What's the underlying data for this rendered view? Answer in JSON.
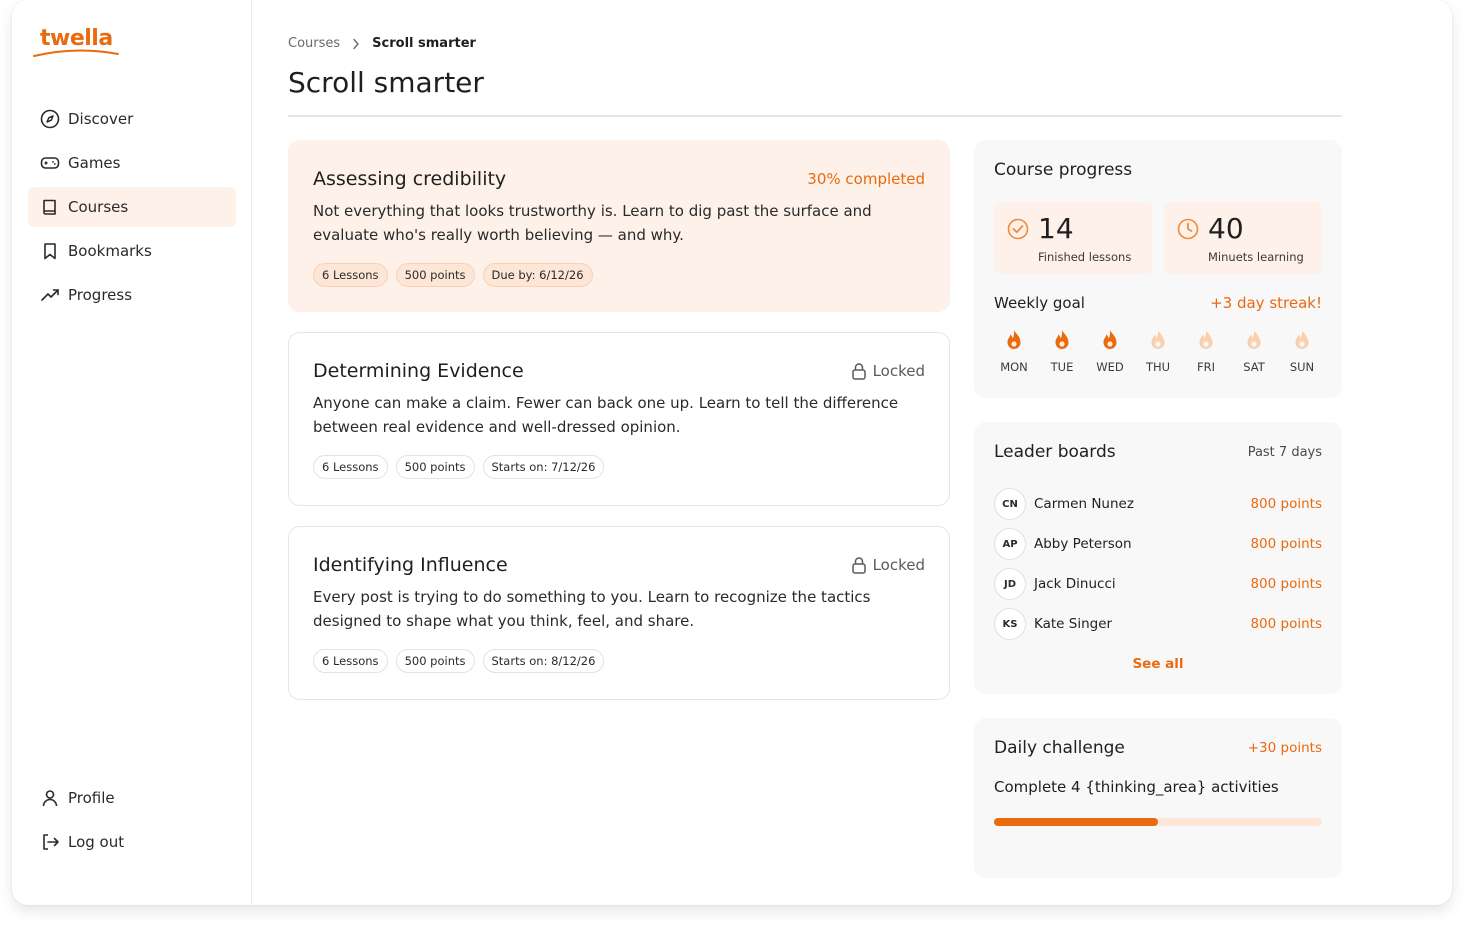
{
  "brand": {
    "name": "twella",
    "accent": "#ea6a10"
  },
  "sidebar": {
    "items": [
      {
        "label": "Discover",
        "icon": "compass-icon"
      },
      {
        "label": "Games",
        "icon": "gamepad-icon"
      },
      {
        "label": "Courses",
        "icon": "book-icon",
        "active": true
      },
      {
        "label": "Bookmarks",
        "icon": "bookmark-icon"
      },
      {
        "label": "Progress",
        "icon": "trending-up-icon"
      }
    ],
    "bottom": [
      {
        "label": "Profile",
        "icon": "user-icon"
      },
      {
        "label": "Log out",
        "icon": "logout-icon"
      }
    ]
  },
  "breadcrumb": {
    "parent": "Courses",
    "current": "Scroll smarter"
  },
  "page": {
    "title": "Scroll smarter"
  },
  "courses": [
    {
      "title": "Assessing credibility",
      "status": "30% completed",
      "description": "Not everything that looks trustworthy is. Learn to dig past the surface and evaluate who's really worth believing — and why.",
      "tags": [
        "6 Lessons",
        "500 points",
        "Due by: 6/12/26"
      ]
    },
    {
      "title": "Determining Evidence",
      "status": "Locked",
      "description": "Anyone can make a claim. Fewer can back one up. Learn to tell the difference between real evidence and well-dressed opinion.",
      "tags": [
        "6 Lessons",
        "500 points",
        "Starts on: 7/12/26"
      ]
    },
    {
      "title": "Identifying Influence",
      "status": "Locked",
      "description": "Every post is trying to do something to you. Learn to recognize the tactics designed to shape what you think, feel, and share.",
      "tags": [
        "6 Lessons",
        "500 points",
        "Starts on: 8/12/26"
      ]
    }
  ],
  "progress": {
    "title": "Course progress",
    "finished_value": "14",
    "finished_label": "Finished lessons",
    "minutes_value": "40",
    "minutes_label": "Minuets learning",
    "weekly_goal_title": "Weekly goal",
    "streak": "+3 day streak!",
    "days": [
      {
        "label": "MON",
        "done": true
      },
      {
        "label": "TUE",
        "done": true
      },
      {
        "label": "WED",
        "done": true
      },
      {
        "label": "THU",
        "done": false
      },
      {
        "label": "FRI",
        "done": false
      },
      {
        "label": "SAT",
        "done": false
      },
      {
        "label": "SUN",
        "done": false
      }
    ]
  },
  "leaderboard": {
    "title": "Leader boards",
    "range": "Past 7 days",
    "rows": [
      {
        "initials": "CN",
        "name": "Carmen Nunez",
        "points": "800 points"
      },
      {
        "initials": "AP",
        "name": "Abby Peterson",
        "points": "800 points"
      },
      {
        "initials": "JD",
        "name": "Jack Dinucci",
        "points": "800 points"
      },
      {
        "initials": "KS",
        "name": "Kate Singer",
        "points": "800 points"
      }
    ],
    "see_all": "See all"
  },
  "daily_challenge": {
    "title": "Daily challenge",
    "points": "+30 points",
    "description": "Complete 4 {thinking_area} activities",
    "progress": 0.5
  }
}
